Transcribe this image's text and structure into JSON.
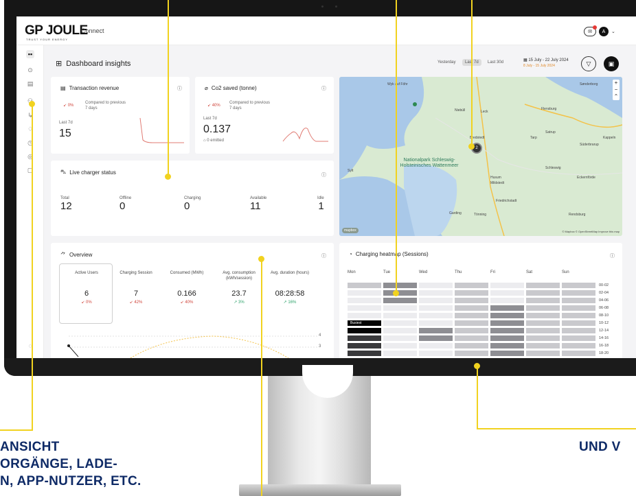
{
  "app": {
    "logo": "GP JOULE",
    "tagline": "TRUST YOUR ENERGY",
    "product": "Connect",
    "avatar_initial": "A"
  },
  "header": {
    "title": "Dashboard insights",
    "ranges": [
      "Yesterday",
      "Last 7d",
      "Last 30d"
    ],
    "active_range": "Last 7d",
    "date_range": "15 July - 22 July 2024",
    "compare_range": "8 July - 15 July 2024"
  },
  "revenue": {
    "title": "Transaction revenue",
    "delta": "0%",
    "compare": "Compared to previous 7 days",
    "period": "Last 7d",
    "value": "15"
  },
  "co2": {
    "title": "Co2 saved (tonne)",
    "delta": "40%",
    "compare": "Compared to previous 7 days",
    "period": "Last 7d",
    "value": "0.137",
    "emitted": "0 emitted"
  },
  "live": {
    "title": "Live charger status",
    "stats": [
      {
        "label": "Total",
        "value": "12"
      },
      {
        "label": "Offline",
        "value": "0"
      },
      {
        "label": "Charging",
        "value": "0"
      },
      {
        "label": "Available",
        "value": "11"
      },
      {
        "label": "Idle",
        "value": "1"
      }
    ]
  },
  "map": {
    "park": "Nationalpark Schleswig-Holsteinisches Wattenmeer",
    "cluster_count": "2",
    "labels": [
      "Sønderborg",
      "Flensburg",
      "Husum",
      "Niebüll",
      "Leck",
      "Tarp",
      "Süderbrarup",
      "Schleswig",
      "Rendsburg",
      "Friedrichstadt",
      "Kappeln",
      "Eckernförde",
      "Garding",
      "Tönning",
      "Mildstedt",
      "Sylt",
      "Wyk auf Föhr",
      "Bredstedt",
      "Satrup"
    ],
    "logo": "mapbox",
    "attribution": "© Mapbox © OpenStreetMap Improve this map"
  },
  "overview": {
    "title": "Overview",
    "metrics": [
      {
        "label": "Active Users",
        "value": "6",
        "delta": "0%",
        "trend": "down"
      },
      {
        "label": "Charging Session",
        "value": "7",
        "delta": "42%",
        "trend": "down"
      },
      {
        "label": "Consumed (MWh)",
        "value": "0.166",
        "delta": "40%",
        "trend": "down"
      },
      {
        "label": "Avg. consumption (kWh/session)",
        "value": "23.7",
        "delta": "3%",
        "trend": "up"
      },
      {
        "label": "Avg. duration (hours)",
        "value": "08:28:58",
        "delta": "16%",
        "trend": "up"
      }
    ],
    "axis": [
      "4",
      "3"
    ]
  },
  "heatmap": {
    "title": "Charging heatmap (Sessions)",
    "days": [
      "Mon",
      "Tue",
      "Wed",
      "Thu",
      "Fri",
      "Sat",
      "Sun"
    ],
    "slots": [
      "00-02",
      "02-04",
      "04-06",
      "06-08",
      "08-10",
      "10-12",
      "12-14",
      "14-16",
      "16-18",
      "18-20"
    ],
    "busiest_label": "Busiest",
    "levels": [
      [
        2,
        3,
        1,
        2,
        1,
        2,
        2
      ],
      [
        1,
        3,
        1,
        2,
        1,
        2,
        2
      ],
      [
        1,
        3,
        1,
        2,
        1,
        2,
        2
      ],
      [
        1,
        1,
        1,
        2,
        3,
        2,
        2
      ],
      [
        1,
        1,
        1,
        2,
        3,
        2,
        2
      ],
      [
        5,
        1,
        1,
        2,
        3,
        2,
        2
      ],
      [
        5,
        1,
        3,
        2,
        3,
        2,
        2
      ],
      [
        4,
        1,
        3,
        2,
        3,
        2,
        2
      ],
      [
        4,
        1,
        1,
        2,
        3,
        2,
        2
      ],
      [
        4,
        1,
        1,
        2,
        3,
        2,
        2
      ]
    ],
    "colors": [
      "#ffffff",
      "#ececef",
      "#c9c9cd",
      "#8e8e93",
      "#3a3a3c",
      "#050505"
    ]
  },
  "captions": {
    "left": [
      "ANSICHT",
      "ORGÄNGE, LADE-",
      "N, APP-NUTZER, ETC."
    ],
    "right": "UND V"
  },
  "colors": {
    "accent": "#f1d21f",
    "caption": "#0e2a66",
    "down": "#d0463c",
    "up": "#2ea36b"
  }
}
